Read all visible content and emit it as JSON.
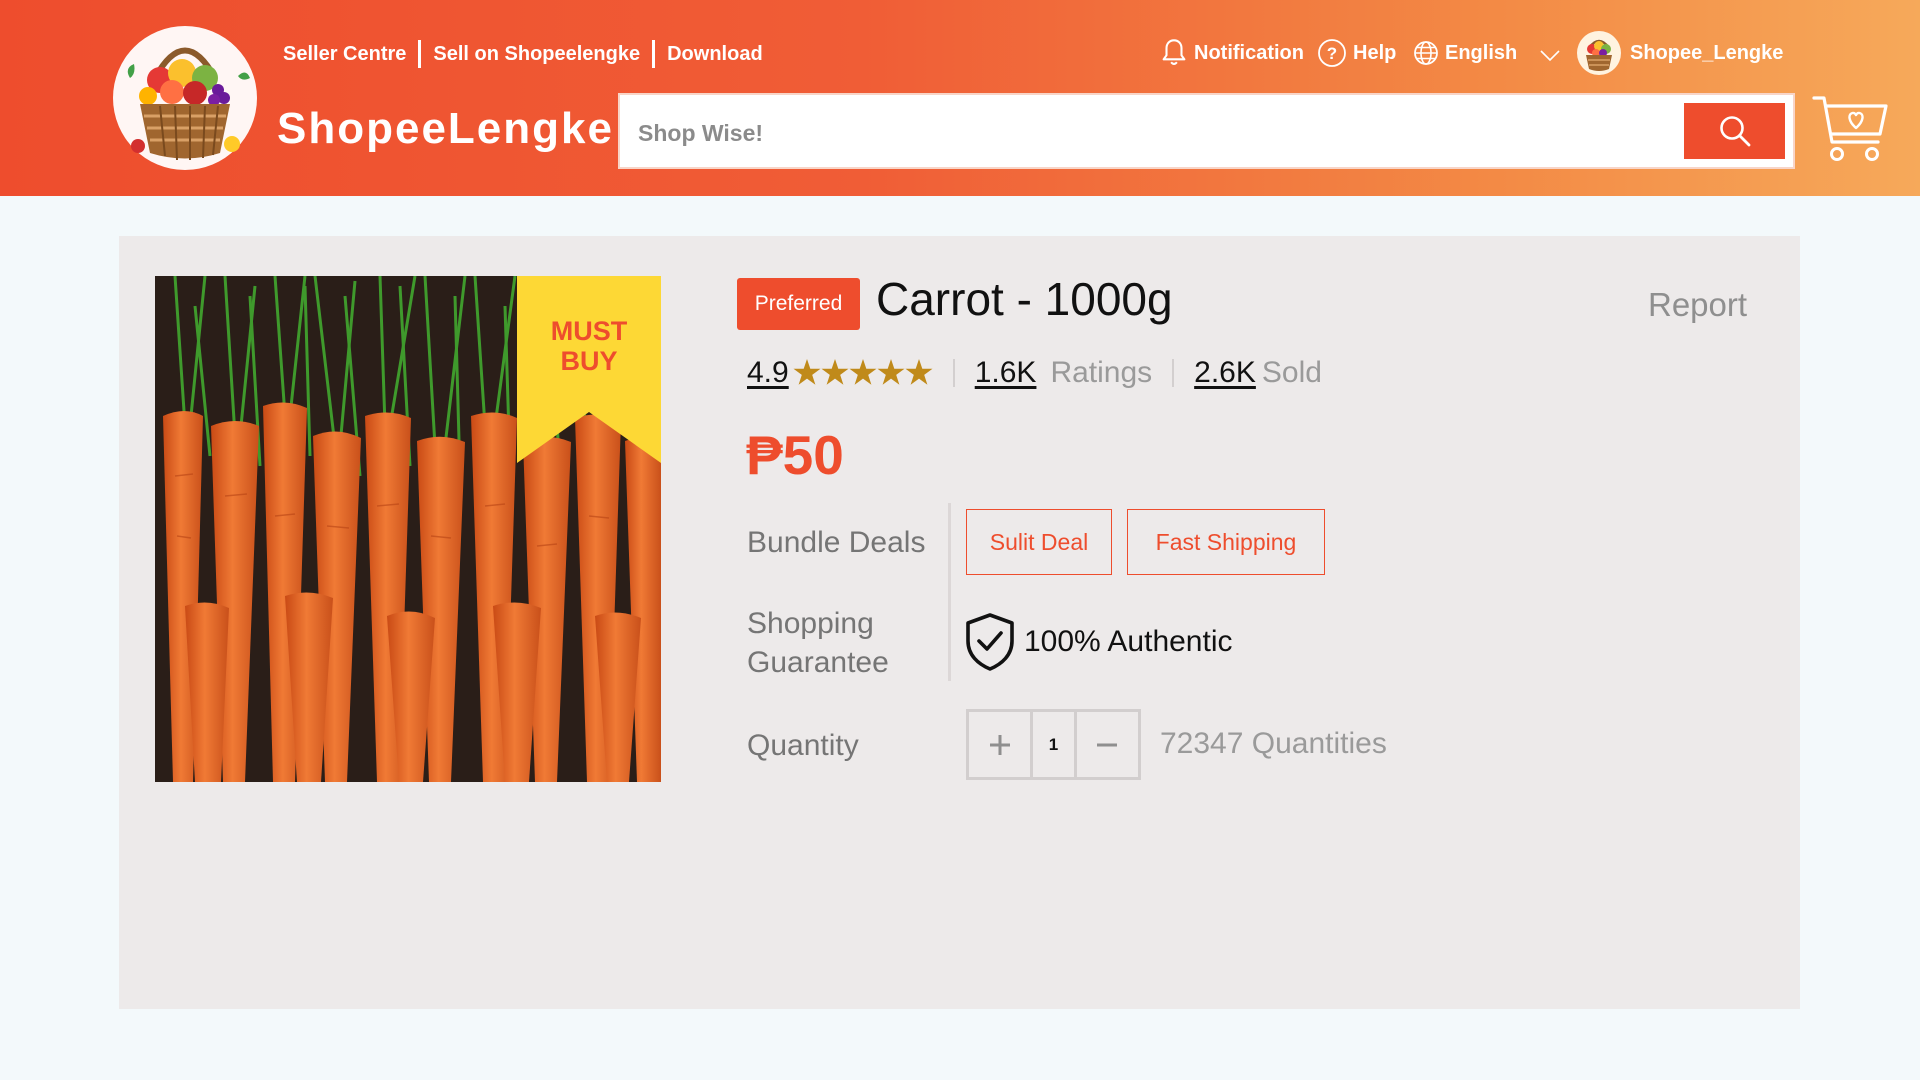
{
  "header": {
    "top_links": [
      "Seller Centre",
      "Sell on Shopeelengke",
      "Download"
    ],
    "brand": "ShopeeLengke",
    "notification_label": "Notification",
    "help_label": "Help",
    "language_label": "English",
    "username": "Shopee_Lengke",
    "search_placeholder": "Shop Wise!",
    "icons": [
      "fruit-basket-logo",
      "bell-icon",
      "help-circle-icon",
      "globe-icon",
      "chevron-down-icon",
      "avatar",
      "search-icon",
      "cart-heart-icon"
    ]
  },
  "product": {
    "badge": "Preferred",
    "title": "Carrot - 1000g",
    "report_label": "Report",
    "ribbon_line1": "MUST",
    "ribbon_line2": "BUY",
    "rating_value": "4.9",
    "rating_stars": 5,
    "ratings_count": "1.6K",
    "ratings_label": "Ratings",
    "sold_count": "2.6K",
    "sold_label": "Sold",
    "price": "₱50",
    "bundle_label": "Bundle Deals",
    "deals": [
      "Sulit Deal",
      "Fast Shipping"
    ],
    "guarantee_label_line1": "Shopping",
    "guarantee_label_line2": "Guarantee",
    "guarantee_text": "100% Authentic",
    "quantity_label": "Quantity",
    "quantity_value": "1",
    "quantity_available": "72347 Quantities"
  },
  "colors": {
    "accent": "#ee4d2d",
    "star": "#c08a1a",
    "ribbon": "#fdd835"
  }
}
